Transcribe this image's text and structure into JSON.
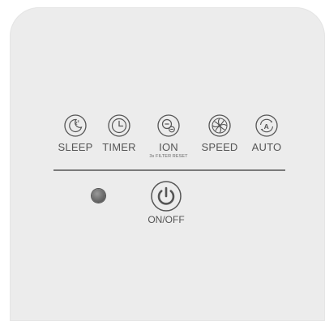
{
  "panel": {
    "buttons": [
      {
        "label": "SLEEP",
        "icon": "sleep-moon-icon"
      },
      {
        "label": "TIMER",
        "icon": "clock-icon"
      },
      {
        "label": "ION",
        "sublabel": "3s FILTER RESET",
        "icon": "ion-icon"
      },
      {
        "label": "SPEED",
        "icon": "fan-icon"
      },
      {
        "label": "AUTO",
        "icon": "auto-a-icon"
      }
    ],
    "power": {
      "label": "ON/OFF",
      "icon": "power-icon"
    },
    "indicator": {
      "icon": "status-led"
    }
  },
  "colors": {
    "panel": "#ececec",
    "icon_stroke": "#555555",
    "divider": "#7a7a7a",
    "led": "#6b6b6b"
  }
}
